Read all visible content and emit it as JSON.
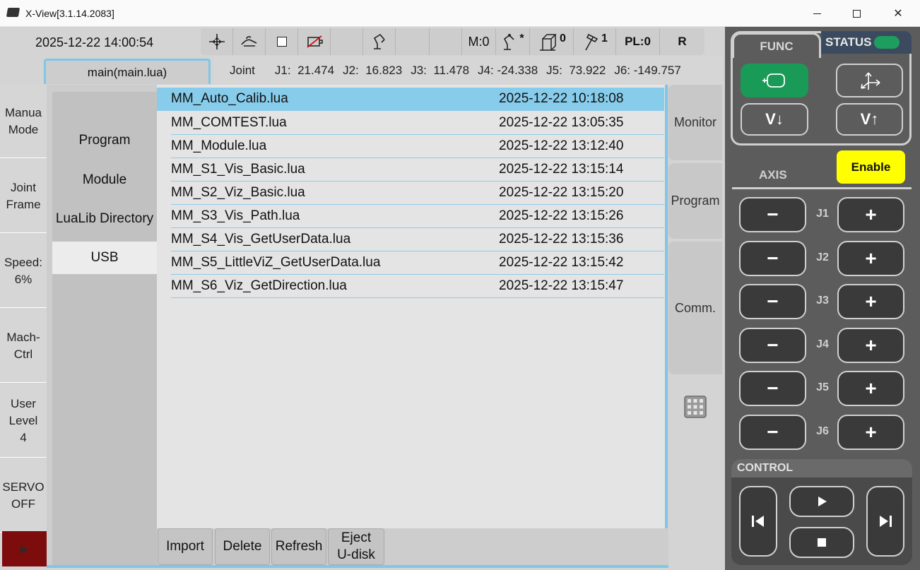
{
  "window": {
    "title": "X-View[3.1.14.2083]",
    "close_glyph": "✕"
  },
  "header": {
    "datetime": "2025-12-22 14:00:54",
    "status": {
      "m": "M:0",
      "robot_sup": "*",
      "frame_num": "0",
      "tool_num": "1",
      "pl": "PL:0",
      "r": "R"
    }
  },
  "program_tab": {
    "label": "main(main.lua)"
  },
  "joints": {
    "label": "Joint",
    "items": [
      {
        "name": "J1:",
        "value": "21.474"
      },
      {
        "name": "J2:",
        "value": "16.823"
      },
      {
        "name": "J3:",
        "value": "11.478"
      },
      {
        "name": "J4:",
        "value": "-24.338"
      },
      {
        "name": "J5:",
        "value": "73.922"
      },
      {
        "name": "J6:",
        "value": "-149.757"
      }
    ]
  },
  "left_modes": [
    {
      "line1": "Manua",
      "line2": "Mode",
      "line3": ""
    },
    {
      "line1": "Joint",
      "line2": "Frame",
      "line3": ""
    },
    {
      "line1": "Speed:",
      "line2": "6%",
      "line3": ""
    },
    {
      "line1": "Mach-",
      "line2": "Ctrl",
      "line3": ""
    },
    {
      "line1": "User",
      "line2": "Level",
      "line3": "4"
    },
    {
      "line1": "SERVO",
      "line2": "OFF",
      "line3": ""
    }
  ],
  "left_red_glyph": "▶",
  "categories": [
    "Program",
    "Module",
    "LuaLib Directory",
    "USB"
  ],
  "active_category": "USB",
  "files": [
    {
      "name": "MM_Auto_Calib.lua",
      "date": "2025-12-22 10:18:08"
    },
    {
      "name": "MM_COMTEST.lua",
      "date": "2025-12-22 13:05:35"
    },
    {
      "name": "MM_Module.lua",
      "date": "2025-12-22 13:12:40"
    },
    {
      "name": "MM_S1_Vis_Basic.lua",
      "date": "2025-12-22 13:15:14"
    },
    {
      "name": "MM_S2_Viz_Basic.lua",
      "date": "2025-12-22 13:15:20"
    },
    {
      "name": "MM_S3_Vis_Path.lua",
      "date": "2025-12-22 13:15:26"
    },
    {
      "name": "MM_S4_Vis_GetUserData.lua",
      "date": "2025-12-22 13:15:36"
    },
    {
      "name": "MM_S5_LittleViZ_GetUserData.lua",
      "date": "2025-12-22 13:15:42"
    },
    {
      "name": "MM_S6_Viz_GetDirection.lua",
      "date": "2025-12-22 13:15:47"
    }
  ],
  "bottom_buttons": {
    "import": "Import",
    "delete": "Delete",
    "refresh": "Refresh",
    "eject_line1": "Eject",
    "eject_line2": "U-disk"
  },
  "side_tabs": {
    "monitor": "Monitor",
    "program": "Program",
    "comm": "Comm."
  },
  "right_panel": {
    "func_label": "FUNC",
    "status_label": "STATUS",
    "v_down": "V↓",
    "v_up": "V↑",
    "enable": "Enable",
    "axis_label": "AXIS",
    "axes": [
      "J1",
      "J2",
      "J3",
      "J4",
      "J5",
      "J6"
    ],
    "minus": "−",
    "plus": "+",
    "control_label": "CONTROL"
  },
  "colors": {
    "selection": "#87cceb",
    "accent_blue": "#7fc7e8",
    "enable": "#ffff00",
    "func_active": "#1a9a57",
    "status_led": "#1e9e5e",
    "servo_red": "#7d0c0c"
  }
}
